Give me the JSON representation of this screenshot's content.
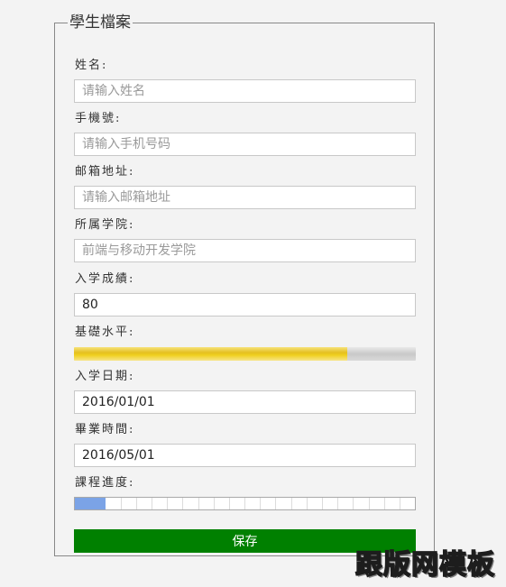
{
  "form": {
    "title": "學生檔案",
    "name": {
      "label": "姓名:",
      "placeholder": "请输入姓名",
      "value": ""
    },
    "phone": {
      "label": "手機號:",
      "placeholder": "请输入手机号码",
      "value": ""
    },
    "email": {
      "label": "邮箱地址:",
      "placeholder": "请输入邮箱地址",
      "value": ""
    },
    "college": {
      "label": "所属学院:",
      "placeholder": "前端与移动开发学院",
      "value": ""
    },
    "score": {
      "label": "入学成績:",
      "value": "80"
    },
    "level": {
      "label": "基礎水平:",
      "fraction": 0.8
    },
    "enroll_date": {
      "label": "入学日期:",
      "value": "2016/01/01"
    },
    "grad_date": {
      "label": "畢業時間:",
      "value": "2016/05/01"
    },
    "progress": {
      "label": "課程進度:",
      "completed_steps": 2,
      "total_steps": 22
    },
    "save_label": "保存"
  },
  "watermark": "跟版网模板",
  "colors": {
    "save": "#008000",
    "meter": "#e4c020",
    "progress": "#7ba3e6"
  }
}
